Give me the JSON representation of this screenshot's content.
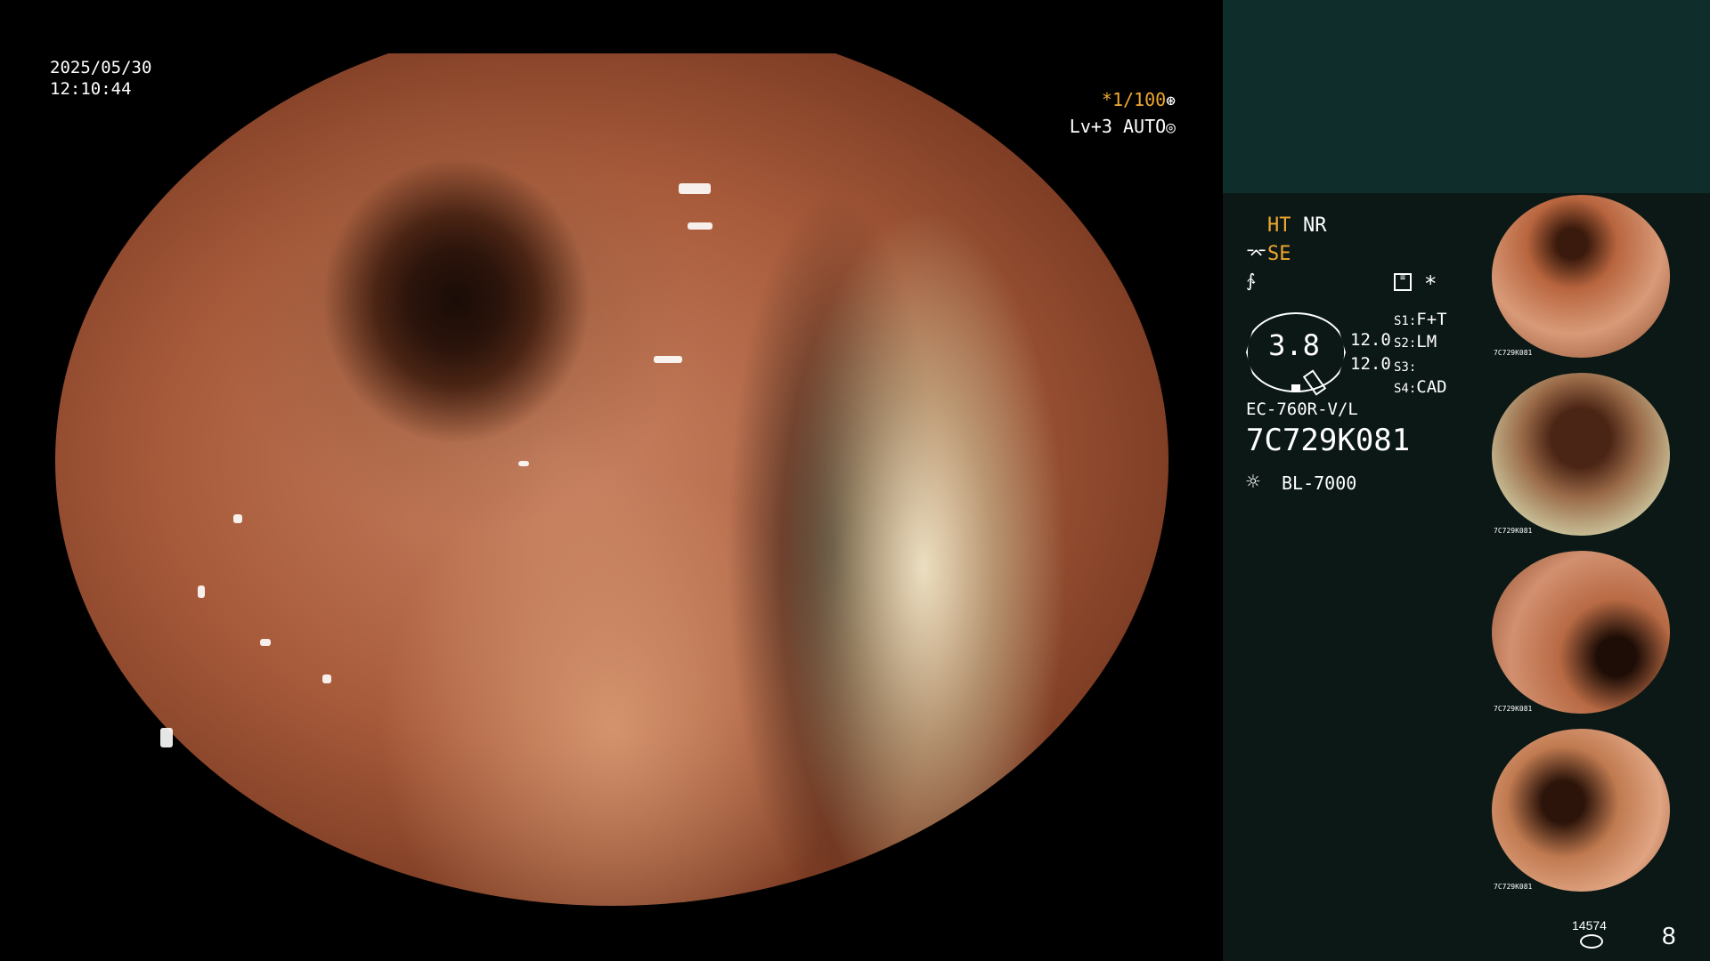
{
  "overlay": {
    "date": "2025/05/30",
    "time": "12:10:44",
    "shutter_speed": "*1/100",
    "shutter_icon": "aperture-icon",
    "iris_level": "Lv+3 AUTO",
    "iris_icon": "iris-icon"
  },
  "panel": {
    "ht": "HT",
    "nr": "NR",
    "se": "SE",
    "se_icon": "structure-enhance-icon",
    "signal_icon": "signal-icon",
    "settings_icon": "settings-icon",
    "asterisk": "*",
    "zoom_value": "3.8",
    "value_1": "12.0",
    "value_2": "12.0",
    "s1_key": "S1:",
    "s1_value": "F+T",
    "s2_key": "S2:",
    "s2_value": "LM",
    "s3_key": "S3:",
    "s3_value": "",
    "s4_key": "S4:",
    "s4_value": "CAD",
    "scope_model": "EC-760R-V/L",
    "scope_serial": "7C729K081",
    "light_icon": "light-source-icon",
    "light_source": "BL-7000",
    "thumbnail_caption": "7C729K081",
    "frame_count": "14574",
    "image_count": "8"
  },
  "colors": {
    "accent_orange": "#f0a830",
    "panel_bg": "#0b1816",
    "panel_top": "#0f2e2b"
  }
}
